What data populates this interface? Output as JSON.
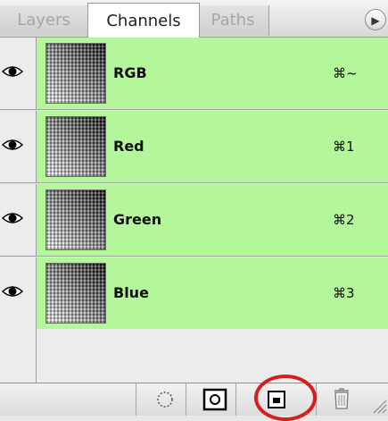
{
  "tabs": [
    {
      "label": "Layers",
      "active": false
    },
    {
      "label": "Channels",
      "active": true
    },
    {
      "label": "Paths",
      "active": false
    }
  ],
  "channels": [
    {
      "name": "RGB",
      "shortcut": "⌘~",
      "visible": true
    },
    {
      "name": "Red",
      "shortcut": "⌘1",
      "visible": true
    },
    {
      "name": "Green",
      "shortcut": "⌘2",
      "visible": true
    },
    {
      "name": "Blue",
      "shortcut": "⌘3",
      "visible": true
    }
  ],
  "toolbar": {
    "buttons": [
      {
        "icon": "dotted-circle-icon"
      },
      {
        "icon": "mask-icon"
      },
      {
        "icon": "new-channel-icon"
      },
      {
        "icon": "trash-icon"
      }
    ]
  },
  "colors": {
    "row_selected": "#b4f79a",
    "highlight": "#d51f1f"
  }
}
